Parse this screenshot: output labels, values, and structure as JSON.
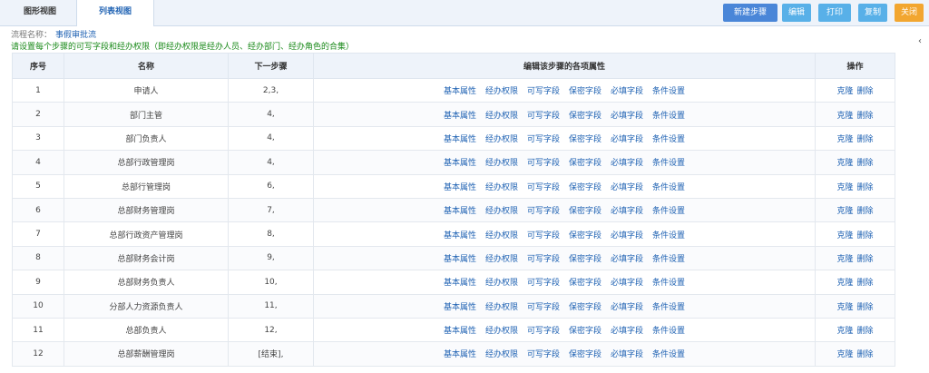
{
  "tabs": {
    "graph": "图形视图",
    "list": "列表视图"
  },
  "toolbar": {
    "new_step": "新建步骤",
    "edit": "编辑",
    "print": "打印",
    "copy": "复制",
    "close": "关闭",
    "colors": {
      "new_step": "#4a86d8",
      "edit": "#58b0e8",
      "close": "#f2a630"
    }
  },
  "flow": {
    "label": "流程名称：",
    "value": "事假审批流"
  },
  "hint": "请设置每个步骤的可写字段和经办权限（即经办权限是经办人员、经办部门、经办角色的合集）",
  "scroll_hint": "‹",
  "table": {
    "headers": [
      "序号",
      "名称",
      "下一步骤",
      "编辑该步骤的各项属性",
      "操作"
    ],
    "props": [
      "基本属性",
      "经办权限",
      "可写字段",
      "保密字段",
      "必填字段",
      "条件设置"
    ],
    "ops": [
      "克隆",
      "删除"
    ],
    "rows": [
      {
        "no": "1",
        "name": "申请人",
        "next": "2,3,"
      },
      {
        "no": "2",
        "name": "部门主管",
        "next": "4,"
      },
      {
        "no": "3",
        "name": "部门负责人",
        "next": "4,"
      },
      {
        "no": "4",
        "name": "总部行政管理岗",
        "next": "4,"
      },
      {
        "no": "5",
        "name": "总部行管理岗",
        "next": "6,"
      },
      {
        "no": "6",
        "name": "总部财务管理岗",
        "next": "7,"
      },
      {
        "no": "7",
        "name": "总部行政资产管理岗",
        "next": "8,"
      },
      {
        "no": "8",
        "name": "总部财务会计岗",
        "next": "9,"
      },
      {
        "no": "9",
        "name": "总部财务负责人",
        "next": "10,"
      },
      {
        "no": "10",
        "name": "分部人力资源负责人",
        "next": "11,"
      },
      {
        "no": "11",
        "name": "总部负责人",
        "next": "12,"
      },
      {
        "no": "12",
        "name": "总部薪酬管理岗",
        "next": "[结束],"
      }
    ]
  }
}
